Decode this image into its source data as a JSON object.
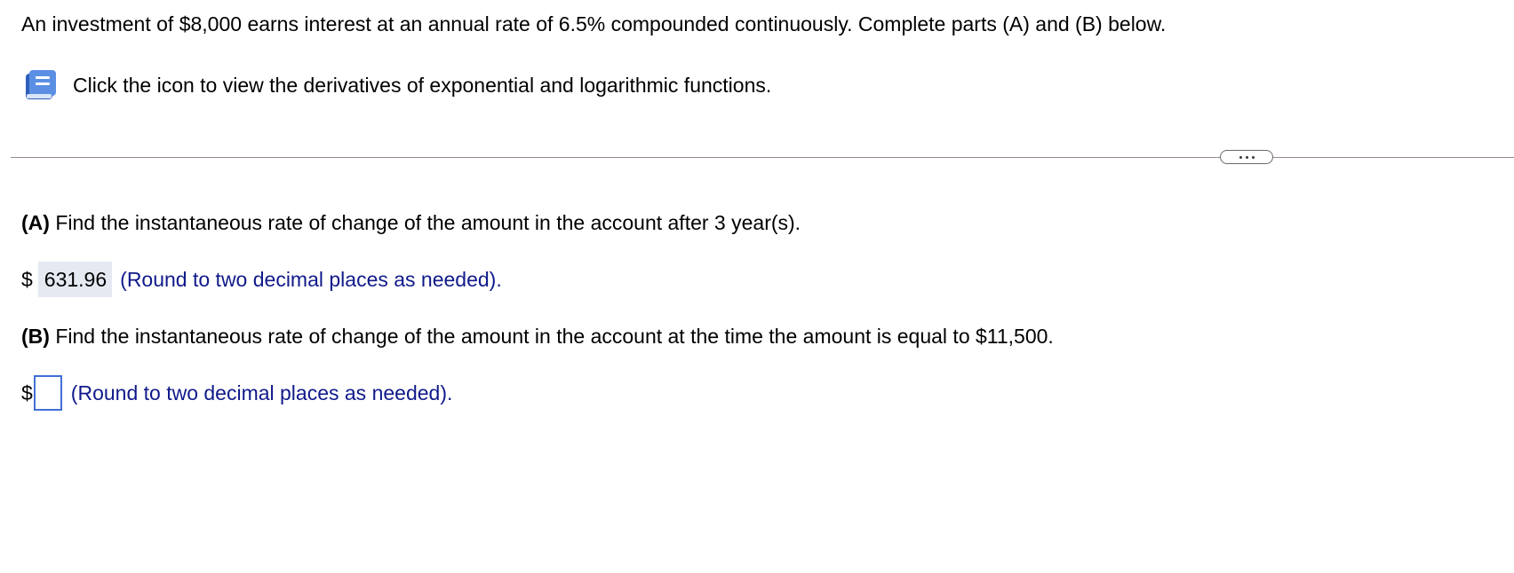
{
  "question": {
    "text": "An investment of $8,000 earns interest at an annual rate of 6.5% compounded continuously. Complete parts (A) and (B) below."
  },
  "help": {
    "icon": "book-icon",
    "icon_color": "#4a7fd8",
    "text": "Click the icon to view the derivatives of exponential and logarithmic functions."
  },
  "divider": {
    "more_icon": "ellipsis-icon"
  },
  "part_a": {
    "label": "(A)",
    "text": " Find the instantaneous rate of change of the amount in the account after 3 year(s).",
    "currency": "$",
    "answer": "631.96",
    "hint": "(Round to two decimal places as needed)."
  },
  "part_b": {
    "label": "(B)",
    "text": " Find the instantaneous rate of change of the amount in the account at the time the amount is equal to $11,500.",
    "currency": "$",
    "answer": "",
    "hint": "(Round to two decimal places as needed)."
  },
  "colors": {
    "hint_text": "#101a8a",
    "answer_highlight": "#e4e9f2",
    "input_border": "#3f6fd6"
  }
}
